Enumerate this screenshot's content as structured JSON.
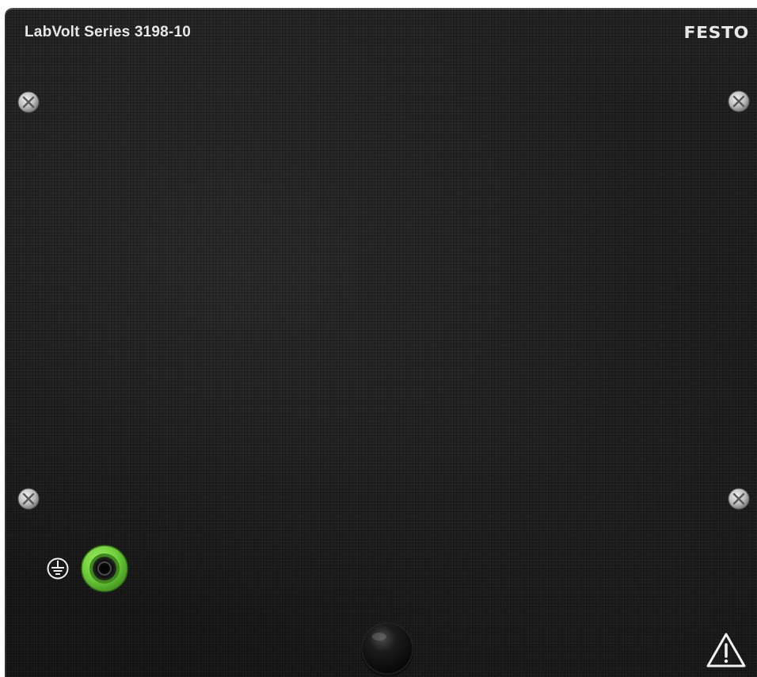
{
  "panel": {
    "title": "LabVolt Series 3198-10",
    "brand": "FESTO"
  },
  "icons": {
    "screws": [
      "screw-icon",
      "screw-icon",
      "screw-icon",
      "screw-icon"
    ],
    "ground": "protective-earth-icon",
    "jack": "banana-jack-icon",
    "knob": "knob-icon",
    "warning": "warning-triangle-icon"
  },
  "colors": {
    "panel": "#171717",
    "text": "#e8e8e8",
    "jack_green": "#6fcf3a"
  }
}
